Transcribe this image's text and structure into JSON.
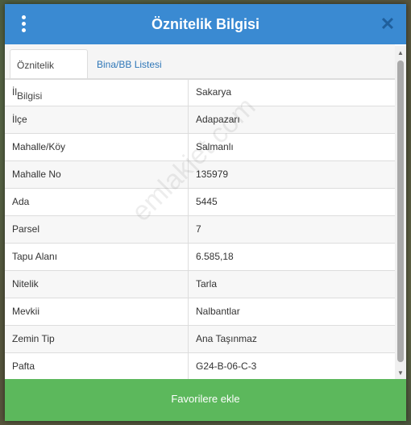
{
  "dialog": {
    "title": "Öznitelik Bilgisi",
    "close_glyph": "✕",
    "menu_icon": "kebab-menu-icon"
  },
  "tabs": [
    {
      "label": "Öznitelik Bilgisi",
      "active": true
    },
    {
      "label": "Bina/BB Listesi",
      "active": false
    }
  ],
  "attributes": [
    {
      "label": "İl",
      "value": "Sakarya"
    },
    {
      "label": "İlçe",
      "value": "Adapazarı"
    },
    {
      "label": "Mahalle/Köy",
      "value": "Salmanlı"
    },
    {
      "label": "Mahalle No",
      "value": "135979"
    },
    {
      "label": "Ada",
      "value": "5445"
    },
    {
      "label": "Parsel",
      "value": "7"
    },
    {
      "label": "Tapu Alanı",
      "value": "6.585,18"
    },
    {
      "label": "Nitelik",
      "value": "Tarla"
    },
    {
      "label": "Mevkii",
      "value": "Nalbantlar"
    },
    {
      "label": "Zemin Tip",
      "value": "Ana Taşınmaz"
    },
    {
      "label": "Pafta",
      "value": "G24-B-06-C-3"
    }
  ],
  "scrollbar": {
    "up_glyph": "▲",
    "down_glyph": "▼"
  },
  "footer": {
    "favorite_label": "Favorilere ekle"
  },
  "watermark": "emlakjet.com",
  "colors": {
    "header": "#3a8ad2",
    "favorite_button": "#5cb85c",
    "tab_link": "#2f77b8"
  }
}
